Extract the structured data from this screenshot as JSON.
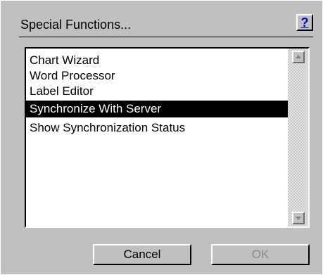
{
  "dialog": {
    "title": "Special Functions...",
    "help_label": "?"
  },
  "list": {
    "items": [
      {
        "label": "Chart Wizard",
        "selected": false
      },
      {
        "label": "Word Processor",
        "selected": false
      },
      {
        "label": "Label Editor",
        "selected": false
      },
      {
        "label": "Synchronize With Server",
        "selected": true
      },
      {
        "label": "Show Synchronization Status",
        "selected": false
      }
    ]
  },
  "scrollbar": {
    "up_icon": "arrow-up-icon",
    "down_icon": "arrow-down-icon"
  },
  "buttons": {
    "cancel_label": "Cancel",
    "ok_label": "OK",
    "ok_enabled": false
  },
  "colors": {
    "dialog_bg": "#c0c0c0",
    "selection_bg": "#000000",
    "selection_fg": "#ffffff",
    "help_link": "#0000cc",
    "disabled_text": "#8a8a8a"
  }
}
